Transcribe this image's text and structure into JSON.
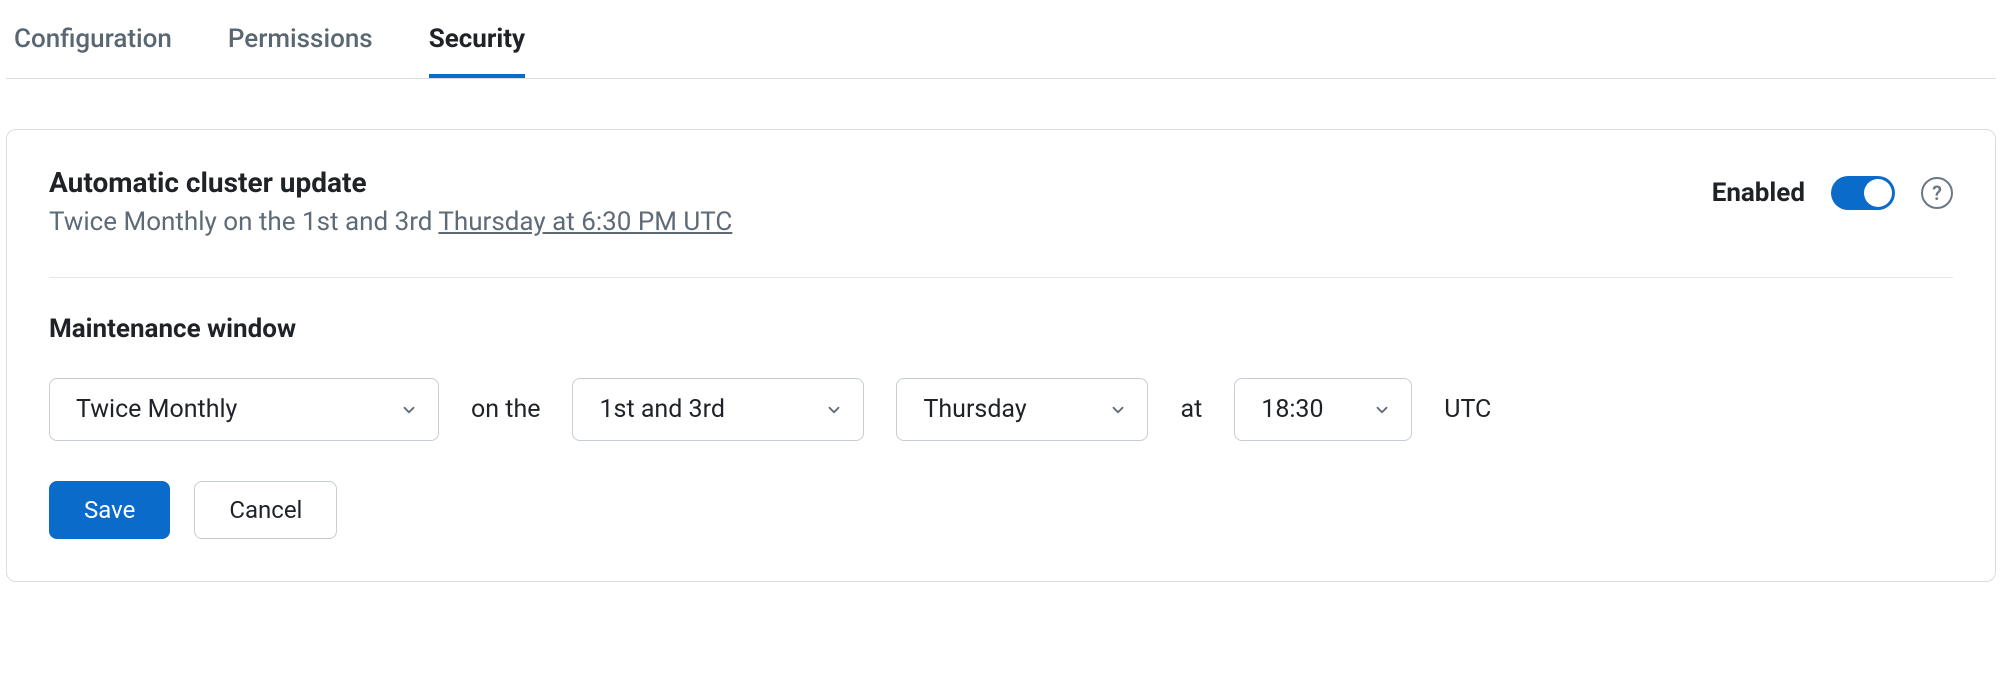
{
  "tabs": {
    "configuration": "Configuration",
    "permissions": "Permissions",
    "security": "Security",
    "active": "security"
  },
  "card": {
    "title": "Automatic cluster update",
    "subtitle_prefix": "Twice Monthly on the 1st and 3rd ",
    "subtitle_link": "Thursday at 6:30 PM UTC",
    "enabled_label": "Enabled",
    "help_glyph": "?"
  },
  "maintenance": {
    "section_title": "Maintenance window",
    "frequency": "Twice Monthly",
    "on_the": "on the",
    "nth_weeks": "1st and 3rd",
    "day": "Thursday",
    "at": "at",
    "time": "18:30",
    "tz": "UTC"
  },
  "buttons": {
    "save": "Save",
    "cancel": "Cancel"
  }
}
